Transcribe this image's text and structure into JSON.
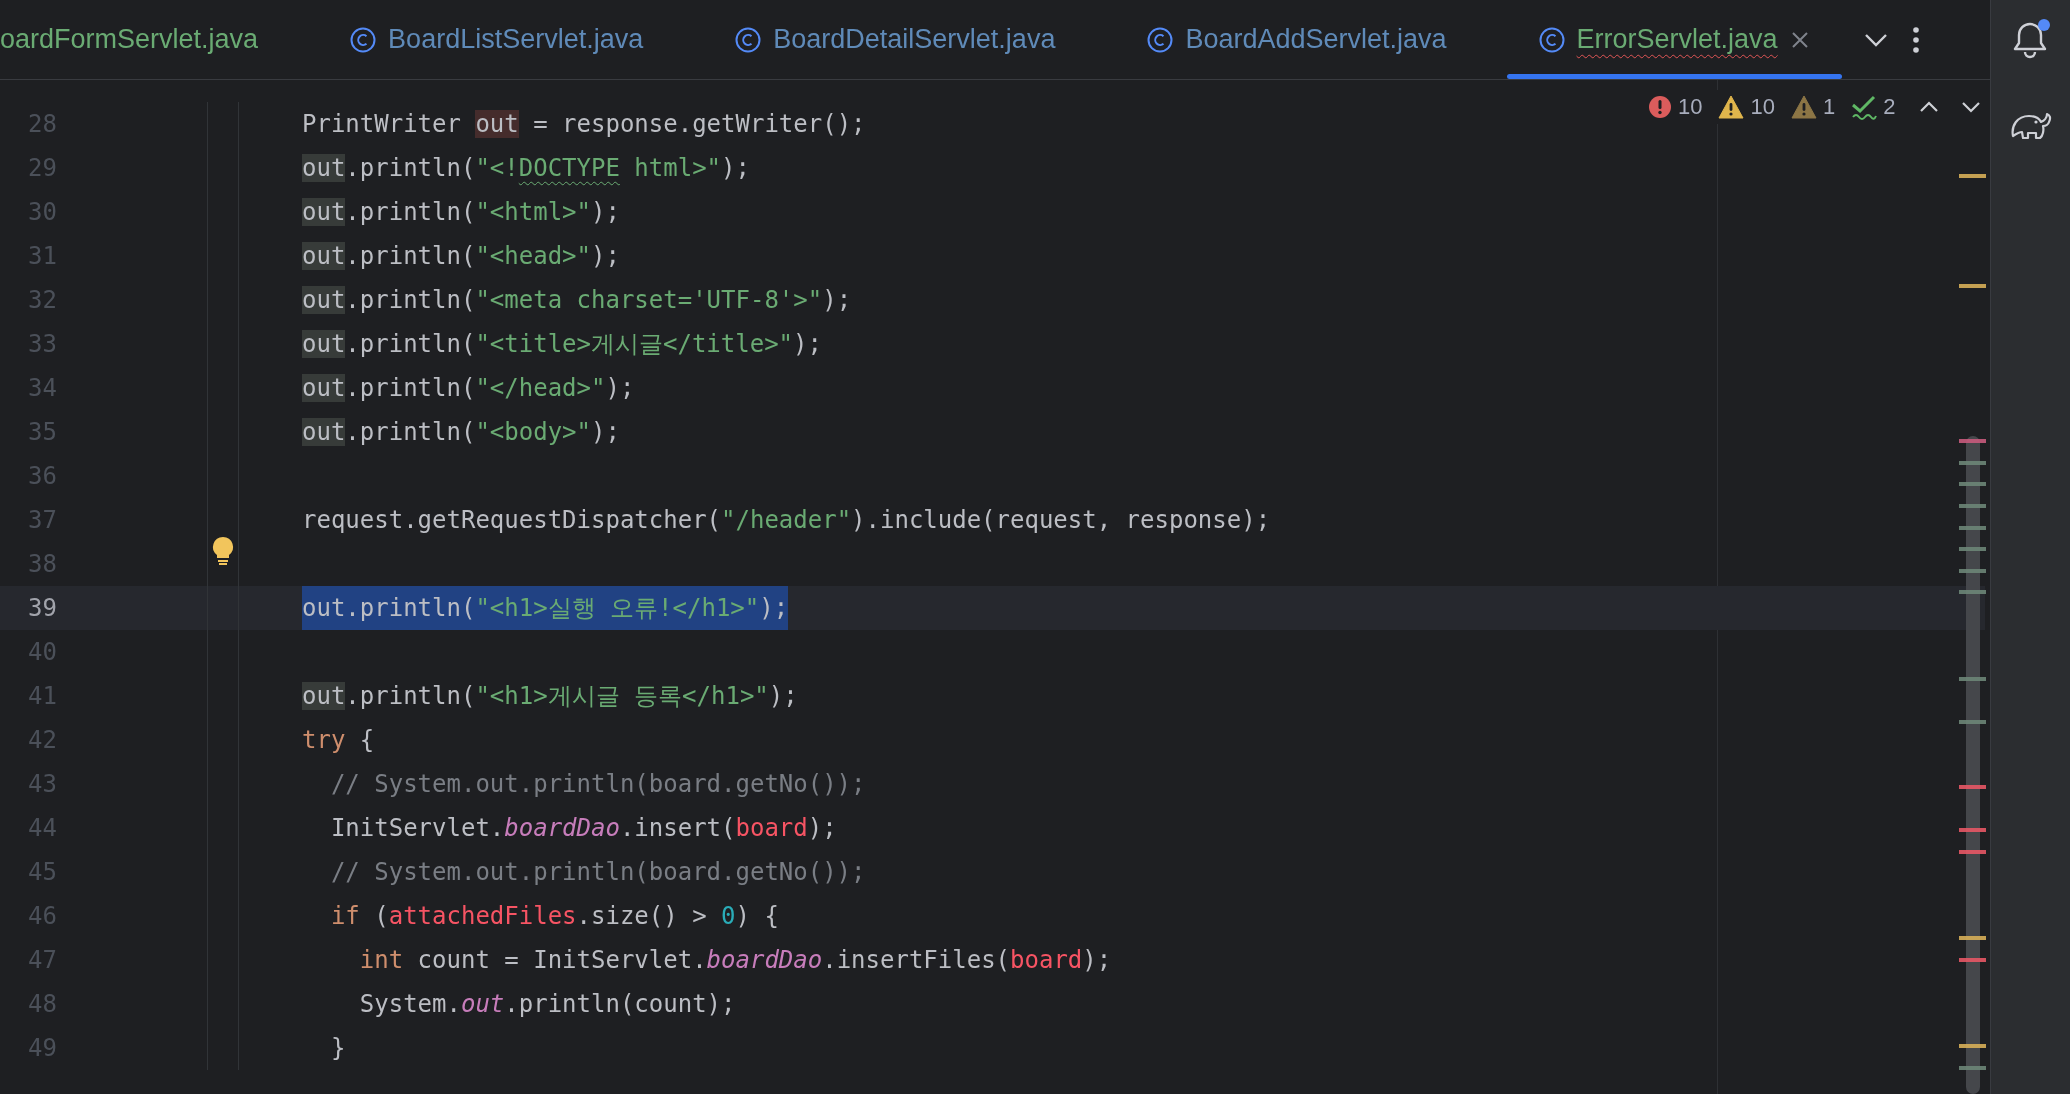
{
  "tabs": [
    {
      "label": "oardFormServlet.java",
      "color": "#6aab73",
      "selected": false,
      "has_errors": false
    },
    {
      "label": "BoardListServlet.java",
      "kind": "class",
      "color": "#5f8ab8",
      "selected": false,
      "has_errors": false
    },
    {
      "label": "BoardDetailServlet.java",
      "kind": "class",
      "color": "#5f8ab8",
      "selected": false,
      "has_errors": false
    },
    {
      "label": "BoardAddServlet.java",
      "kind": "class",
      "color": "#5f8ab8",
      "selected": false,
      "has_errors": false
    },
    {
      "label": "ErrorServlet.java",
      "kind": "class",
      "color": "#6aab73",
      "selected": true,
      "has_errors": true
    }
  ],
  "inspections": [
    {
      "kind": "error",
      "count": "10"
    },
    {
      "kind": "warning",
      "count": "10"
    },
    {
      "kind": "weak-warning",
      "count": "1"
    },
    {
      "kind": "typo",
      "count": "2"
    }
  ],
  "notifications": {
    "unread": true
  },
  "lines": [
    {
      "number": "28",
      "selected": false,
      "tokens": [
        {
          "kind": "plain",
          "text": "PrintWriter "
        },
        {
          "kind": "declaration",
          "text": "out"
        },
        {
          "kind": "plain",
          "text": " = response.getWriter();"
        }
      ]
    },
    {
      "number": "29",
      "selected": false,
      "tokens": [
        {
          "kind": "usage",
          "text": "out"
        },
        {
          "kind": "plain",
          "text": ".println("
        },
        {
          "kind": "string",
          "text": "\"<!"
        },
        {
          "kind": "typo",
          "text": "DOCTYPE"
        },
        {
          "kind": "string",
          "text": " html>\""
        },
        {
          "kind": "plain",
          "text": ");"
        }
      ]
    },
    {
      "number": "30",
      "selected": false,
      "tokens": [
        {
          "kind": "usage",
          "text": "out"
        },
        {
          "kind": "plain",
          "text": ".println("
        },
        {
          "kind": "string",
          "text": "\"<html>\""
        },
        {
          "kind": "plain",
          "text": ");"
        }
      ]
    },
    {
      "number": "31",
      "selected": false,
      "tokens": [
        {
          "kind": "usage",
          "text": "out"
        },
        {
          "kind": "plain",
          "text": ".println("
        },
        {
          "kind": "string",
          "text": "\"<head>\""
        },
        {
          "kind": "plain",
          "text": ");"
        }
      ]
    },
    {
      "number": "32",
      "selected": false,
      "tokens": [
        {
          "kind": "usage",
          "text": "out"
        },
        {
          "kind": "plain",
          "text": ".println("
        },
        {
          "kind": "string",
          "text": "\"<meta charset='UTF-8'>\""
        },
        {
          "kind": "plain",
          "text": ");"
        }
      ]
    },
    {
      "number": "33",
      "selected": false,
      "tokens": [
        {
          "kind": "usage",
          "text": "out"
        },
        {
          "kind": "plain",
          "text": ".println("
        },
        {
          "kind": "string",
          "text": "\"<title>게시글</title>\""
        },
        {
          "kind": "plain",
          "text": ");"
        }
      ]
    },
    {
      "number": "34",
      "selected": false,
      "tokens": [
        {
          "kind": "usage",
          "text": "out"
        },
        {
          "kind": "plain",
          "text": ".println("
        },
        {
          "kind": "string",
          "text": "\"</head>\""
        },
        {
          "kind": "plain",
          "text": ");"
        }
      ]
    },
    {
      "number": "35",
      "selected": false,
      "tokens": [
        {
          "kind": "usage",
          "text": "out"
        },
        {
          "kind": "plain",
          "text": ".println("
        },
        {
          "kind": "string",
          "text": "\"<body>\""
        },
        {
          "kind": "plain",
          "text": ");"
        }
      ]
    },
    {
      "number": "36",
      "selected": false
    },
    {
      "number": "37",
      "selected": false,
      "tokens": [
        {
          "kind": "plain",
          "text": "request.getRequestDispatcher("
        },
        {
          "kind": "string",
          "text": "\"/header\""
        },
        {
          "kind": "plain",
          "text": ").include(request, response);"
        }
      ]
    },
    {
      "number": "38",
      "selected": false,
      "bulb": true
    },
    {
      "number": "39",
      "selected": true,
      "tokens": [
        {
          "kind": "plain",
          "text": "out.println("
        },
        {
          "kind": "string",
          "text": "\"<h1>실행 오류!</h1>\""
        },
        {
          "kind": "plain",
          "text": ");"
        }
      ]
    },
    {
      "number": "40",
      "selected": false
    },
    {
      "number": "41",
      "selected": false,
      "tokens": [
        {
          "kind": "usage",
          "text": "out"
        },
        {
          "kind": "plain",
          "text": ".println("
        },
        {
          "kind": "string",
          "text": "\"<h1>게시글 등록</h1>\""
        },
        {
          "kind": "plain",
          "text": ");"
        }
      ]
    },
    {
      "number": "42",
      "selected": false,
      "tokens": [
        {
          "kind": "keyword",
          "text": "try"
        },
        {
          "kind": "plain",
          "text": " {"
        }
      ]
    },
    {
      "number": "43",
      "selected": false,
      "tokens": [
        {
          "kind": "comment",
          "text": "  // System.out.println(board.getNo());"
        }
      ]
    },
    {
      "number": "44",
      "selected": false,
      "tokens": [
        {
          "kind": "plain",
          "text": "  InitServlet."
        },
        {
          "kind": "static",
          "text": "boardDao"
        },
        {
          "kind": "plain",
          "text": ".insert("
        },
        {
          "kind": "unresolved",
          "text": "board"
        },
        {
          "kind": "plain",
          "text": ");"
        }
      ]
    },
    {
      "number": "45",
      "selected": false,
      "tokens": [
        {
          "kind": "comment",
          "text": "  // System.out.println(board.getNo());"
        }
      ]
    },
    {
      "number": "46",
      "selected": false,
      "tokens": [
        {
          "kind": "keyword",
          "text": "  if"
        },
        {
          "kind": "plain",
          "text": " ("
        },
        {
          "kind": "unresolved",
          "text": "attachedFiles"
        },
        {
          "kind": "plain",
          "text": ".size() > "
        },
        {
          "kind": "number",
          "text": "0"
        },
        {
          "kind": "plain",
          "text": ") {"
        }
      ]
    },
    {
      "number": "47",
      "selected": false,
      "tokens": [
        {
          "kind": "keyword",
          "text": "    int"
        },
        {
          "kind": "plain",
          "text": " count = InitServlet."
        },
        {
          "kind": "static",
          "text": "boardDao"
        },
        {
          "kind": "plain",
          "text": ".insertFiles("
        },
        {
          "kind": "unresolved",
          "text": "board"
        },
        {
          "kind": "plain",
          "text": ");"
        }
      ]
    },
    {
      "number": "48",
      "selected": false,
      "tokens": [
        {
          "kind": "plain",
          "text": "    System."
        },
        {
          "kind": "static",
          "text": "out"
        },
        {
          "kind": "plain",
          "text": ".println(count);"
        }
      ]
    },
    {
      "number": "49",
      "selected": false,
      "tokens": [
        {
          "kind": "plain",
          "text": "  }"
        }
      ]
    }
  ]
}
